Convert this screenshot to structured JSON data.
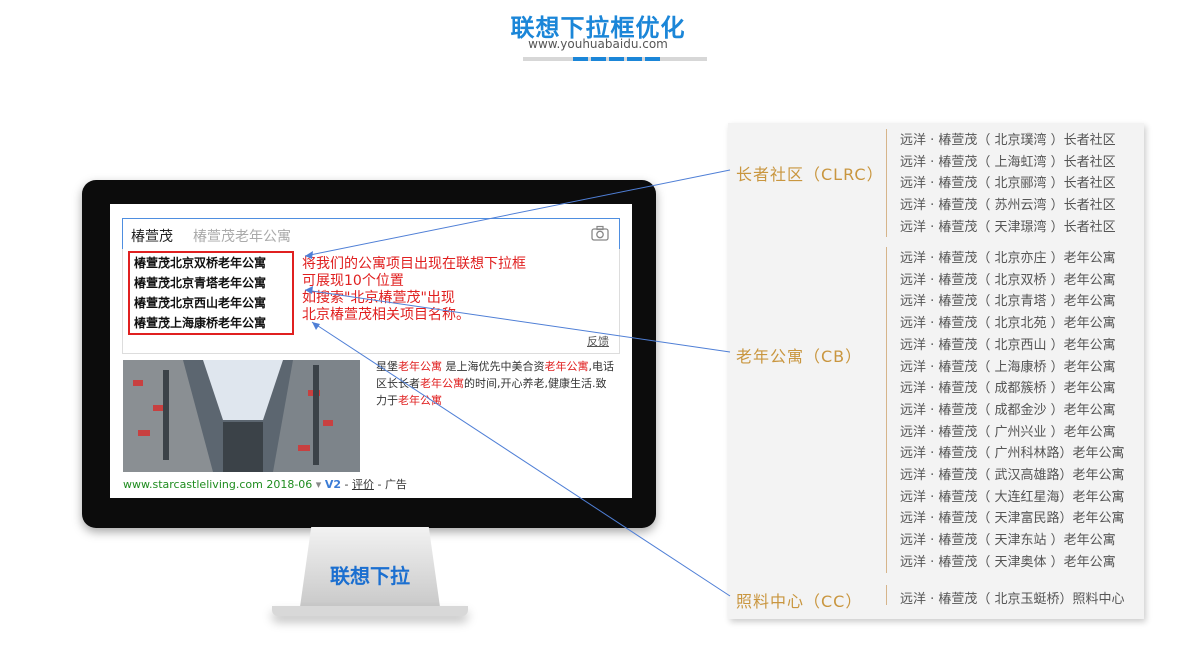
{
  "header": {
    "title": "联想下拉框优化",
    "subtitle": "www.youhuabaidu.com"
  },
  "colors": {
    "brand": "#1b86d8",
    "accent": "#e02020",
    "category": "#c9963f"
  },
  "search": {
    "query": "椿萱茂",
    "hint": "椿萱茂老年公寓",
    "camera_icon": "camera-icon"
  },
  "suggestions": [
    "椿萱茂北京双桥老年公寓",
    "椿萱茂北京青塔老年公寓",
    "椿萱茂北京西山老年公寓",
    "椿萱茂上海康桥老年公寓"
  ],
  "annotation": [
    "将我们的公寓项目出现在联想下拉框",
    "可展现10个位置",
    "如搜索\"北京椿萱茂\"出现",
    "北京椿萱茂相关项目名称。"
  ],
  "feedback_label": "反馈",
  "ad": {
    "desc_parts": [
      {
        "t": "星堡",
        "hl": false
      },
      {
        "t": "老年公寓",
        "hl": true
      },
      {
        "t": " 是上海优先中美合资",
        "hl": false
      },
      {
        "t": "老年公寓",
        "hl": true
      },
      {
        "t": ",电话区长长者",
        "hl": false
      },
      {
        "t": "老年公寓",
        "hl": true
      },
      {
        "t": "的时间,开心养老,健康生活.致力于",
        "hl": false
      },
      {
        "t": "老年公寓",
        "hl": true
      }
    ],
    "url": "www.starcastleliving.com",
    "date": "2018-06",
    "v_badge": "V2",
    "review": "评价",
    "ad_label": "广告"
  },
  "stand_label": "联想下拉",
  "panel": {
    "categories": [
      {
        "name": "长者社区（CLRC）",
        "items": [
          "远洋 · 椿萱茂（ 北京璞湾 ）长者社区",
          "远洋 · 椿萱茂（ 上海虹湾 ）长者社区",
          "远洋 · 椿萱茂（ 北京郦湾 ）长者社区",
          "远洋 · 椿萱茂（ 苏州云湾 ）长者社区",
          "远洋 · 椿萱茂（ 天津璟湾 ）长者社区"
        ]
      },
      {
        "name": "老年公寓（CB）",
        "items": [
          "远洋 · 椿萱茂（ 北京亦庄 ）老年公寓",
          "远洋 · 椿萱茂（ 北京双桥 ）老年公寓",
          "远洋 · 椿萱茂（ 北京青塔 ）老年公寓",
          "远洋 · 椿萱茂（ 北京北苑 ）老年公寓",
          "远洋 · 椿萱茂（ 北京西山 ）老年公寓",
          "远洋 · 椿萱茂（ 上海康桥 ）老年公寓",
          "远洋 · 椿萱茂（ 成都簇桥 ）老年公寓",
          "远洋 · 椿萱茂（ 成都金沙 ）老年公寓",
          "远洋 · 椿萱茂（ 广州兴业 ）老年公寓",
          "远洋 · 椿萱茂（ 广州科林路）老年公寓",
          "远洋 · 椿萱茂（ 武汉高雄路）老年公寓",
          "远洋 · 椿萱茂（ 大连红星海）老年公寓",
          "远洋 · 椿萱茂（ 天津富民路）老年公寓",
          "远洋 · 椿萱茂（ 天津东站 ）老年公寓",
          "远洋 · 椿萱茂（ 天津奥体 ）老年公寓"
        ]
      },
      {
        "name": "照料中心（CC）",
        "items": [
          "远洋 · 椿萱茂（ 北京玉蜓桥）照料中心"
        ]
      }
    ]
  }
}
